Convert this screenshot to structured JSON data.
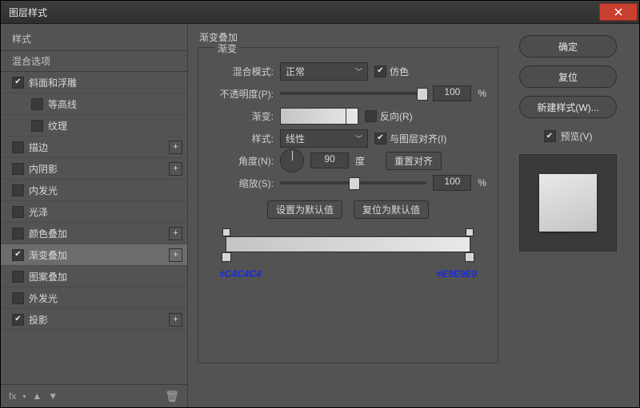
{
  "window": {
    "title": "图层样式"
  },
  "sidebar": {
    "header": "样式",
    "subheader": "混合选项",
    "items": [
      {
        "label": "斜面和浮雕",
        "checked": true,
        "plus": false,
        "indent": false
      },
      {
        "label": "等高线",
        "checked": false,
        "plus": false,
        "indent": true
      },
      {
        "label": "纹理",
        "checked": false,
        "plus": false,
        "indent": true
      },
      {
        "label": "描边",
        "checked": false,
        "plus": true,
        "indent": false
      },
      {
        "label": "内阴影",
        "checked": false,
        "plus": true,
        "indent": false
      },
      {
        "label": "内发光",
        "checked": false,
        "plus": false,
        "indent": false
      },
      {
        "label": "光泽",
        "checked": false,
        "plus": false,
        "indent": false
      },
      {
        "label": "颜色叠加",
        "checked": false,
        "plus": true,
        "indent": false
      },
      {
        "label": "渐变叠加",
        "checked": true,
        "plus": true,
        "indent": false,
        "selected": true
      },
      {
        "label": "图案叠加",
        "checked": false,
        "plus": false,
        "indent": false
      },
      {
        "label": "外发光",
        "checked": false,
        "plus": false,
        "indent": false
      },
      {
        "label": "投影",
        "checked": true,
        "plus": true,
        "indent": false
      }
    ],
    "footer_fx": "fx"
  },
  "panel": {
    "title": "渐变叠加",
    "legend": "渐变",
    "blend_mode_label": "混合模式:",
    "blend_mode_value": "正常",
    "dither_label": "仿色",
    "dither_checked": true,
    "opacity_label": "不透明度(P):",
    "opacity_value": "100",
    "opacity_unit": "%",
    "opacity_thumb_pct": 100,
    "gradient_label": "渐变:",
    "reverse_label": "反向(R)",
    "reverse_checked": false,
    "style_label": "样式:",
    "style_value": "线性",
    "align_with_layer_label": "与图层对齐(I)",
    "align_with_layer_checked": true,
    "angle_label": "角度(N):",
    "angle_value": "90",
    "angle_unit": "度",
    "reset_align_label": "重置对齐",
    "scale_label": "缩放(S):",
    "scale_value": "100",
    "scale_unit": "%",
    "scale_thumb_pct": 50,
    "set_default": "设置为默认值",
    "reset_default": "复位为默认值",
    "hex_left": "#C4C4C4",
    "hex_right": "#E9E9E9"
  },
  "buttons": {
    "ok": "确定",
    "cancel": "复位",
    "new_style": "新建样式(W)...",
    "preview_label": "预览(V)",
    "preview_checked": true
  }
}
